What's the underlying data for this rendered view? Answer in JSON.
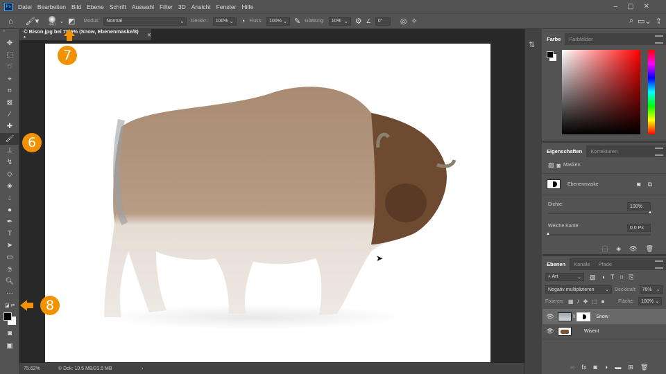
{
  "menu": {
    "logo": "Ps",
    "items": [
      "Datei",
      "Bearbeiten",
      "Bild",
      "Ebene",
      "Schrift",
      "Auswahl",
      "Filter",
      "3D",
      "Ansicht",
      "Fenster",
      "Hilfe"
    ]
  },
  "options": {
    "brush_size": "440",
    "modus_label": "Modus:",
    "modus_value": "Normal",
    "deckkr_label": "Deckkr.:",
    "deckkr_value": "100%",
    "fluss_label": "Fluss:",
    "fluss_value": "100%",
    "glaettung_label": "Glättung:",
    "glaettung_value": "10%",
    "angle_value": "0°"
  },
  "document": {
    "tab_title": "© Bison.jpg bei 75,6% (Snow, Ebenenmaske/8) *",
    "zoom": "75.62%",
    "doc_info": "© Dok: 10.5 MB/23.5 MB",
    "arrow": "›"
  },
  "annotations": {
    "a6": "6",
    "a7": "7",
    "a8": "8",
    "accent": "#f39200"
  },
  "color_panel": {
    "tabs": [
      "Farbe",
      "Farbfelder"
    ]
  },
  "properties": {
    "tabs": [
      "Eigenschaften",
      "Korrekturen"
    ],
    "section": "Masken",
    "mask_label": "Ebenenmaske",
    "dichte_label": "Dichte:",
    "dichte_value": "100%",
    "kante_label": "Weiche Kante:",
    "kante_value": "0.0 Px",
    "dichte_fraction": 1.0,
    "kante_fraction": 0.0
  },
  "layers": {
    "tabs": [
      "Ebenen",
      "Kanäle",
      "Pfade"
    ],
    "filter": "Art",
    "blend_mode": "Negativ multiplizieren",
    "opacity_label": "Deckkraft:",
    "opacity_value": "76%",
    "lock_label": "Fixieren:",
    "fill_label": "Fläche:",
    "fill_value": "100%",
    "items": [
      {
        "name": "Snow"
      },
      {
        "name": "Wisent"
      }
    ]
  }
}
